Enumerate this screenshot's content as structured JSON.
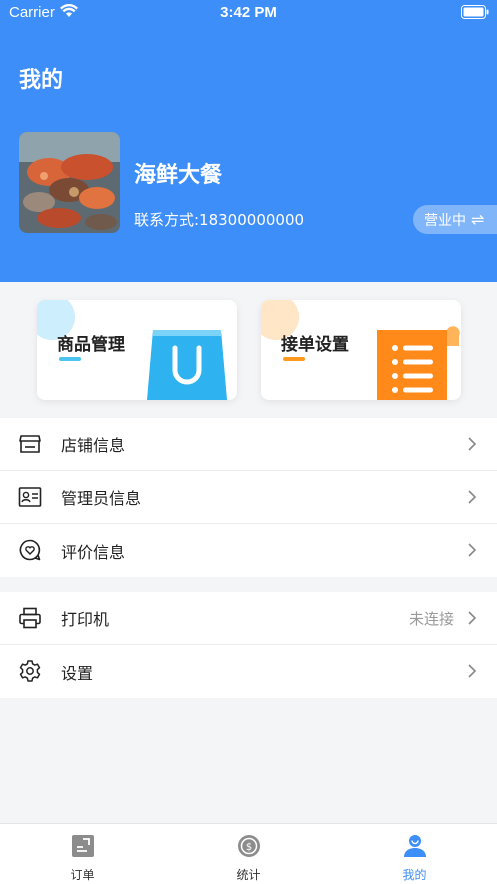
{
  "status_bar": {
    "carrier": "Carrier",
    "time": "3:42 PM"
  },
  "header": {
    "title": "我的",
    "shop_name": "海鲜大餐",
    "contact": "联系方式:18300000000",
    "business_status": "营业中"
  },
  "cards": [
    {
      "label": "商品管理",
      "accent": "#4cc4f2",
      "blob": "#cdeefd"
    },
    {
      "label": "接单设置",
      "accent": "#ff9a1f",
      "blob": "#ffe6c6"
    }
  ],
  "menu_primary": [
    {
      "label": "店铺信息",
      "icon": "store-icon"
    },
    {
      "label": "管理员信息",
      "icon": "id-card-icon"
    },
    {
      "label": "评价信息",
      "icon": "review-heart-icon"
    }
  ],
  "menu_secondary": [
    {
      "label": "打印机",
      "value": "未连接",
      "icon": "printer-icon"
    },
    {
      "label": "设置",
      "icon": "gear-icon"
    }
  ],
  "tabbar": [
    {
      "label": "订单",
      "icon": "order-icon"
    },
    {
      "label": "统计",
      "icon": "stats-coin-icon"
    },
    {
      "label": "我的",
      "icon": "profile-icon",
      "active": true
    }
  ],
  "colors": {
    "primary": "#3d8ef8",
    "background": "#f4f5f7"
  }
}
